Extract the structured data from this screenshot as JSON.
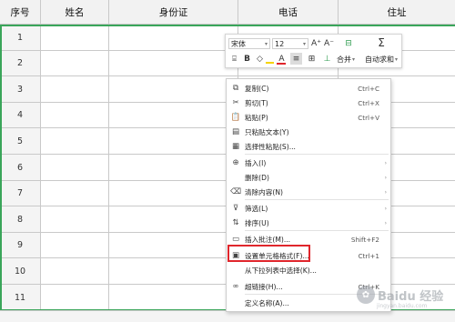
{
  "sheet": {
    "headers": [
      "序号",
      "姓名",
      "身份证",
      "电话",
      "住址"
    ],
    "row_numbers": [
      "1",
      "2",
      "3",
      "4",
      "5",
      "6",
      "7",
      "8",
      "9",
      "10",
      "11"
    ]
  },
  "mini_toolbar": {
    "font_name": "宋体",
    "font_size": "12",
    "grow_font": "A⁺",
    "shrink_font": "A⁻",
    "bold": "B",
    "font_color": "A",
    "merge_label": "合并",
    "autosum_label": "自动求和",
    "accent_colors": {
      "font_color_bar": "#e0262c",
      "fill_color_bar": "#f5d300"
    }
  },
  "context_menu": {
    "items": [
      {
        "label": "复制(C)",
        "shortcut": "Ctrl+C",
        "icon": "copy-icon"
      },
      {
        "label": "剪切(T)",
        "shortcut": "Ctrl+X",
        "icon": "cut-icon"
      },
      {
        "label": "粘贴(P)",
        "shortcut": "Ctrl+V",
        "icon": "paste-icon"
      },
      {
        "label": "只粘贴文本(Y)",
        "shortcut": "",
        "icon": "paste-text-icon"
      },
      {
        "label": "选择性粘贴(S)...",
        "shortcut": "",
        "icon": "paste-special-icon"
      },
      {
        "label": "插入(I)",
        "shortcut": "",
        "icon": "insert-icon",
        "submenu": true
      },
      {
        "label": "删除(D)",
        "shortcut": "",
        "icon": "",
        "submenu": true
      },
      {
        "label": "清除内容(N)",
        "shortcut": "",
        "icon": "eraser-icon",
        "submenu": true
      },
      {
        "label": "筛选(L)",
        "shortcut": "",
        "icon": "filter-icon",
        "submenu": true
      },
      {
        "label": "排序(U)",
        "shortcut": "",
        "icon": "sort-icon",
        "submenu": true
      },
      {
        "label": "插入批注(M)...",
        "shortcut": "Shift+F2",
        "icon": "comment-icon"
      },
      {
        "label": "设置单元格格式(F)...",
        "shortcut": "Ctrl+1",
        "icon": "format-cells-icon"
      },
      {
        "label": "从下拉列表中选择(K)...",
        "shortcut": "",
        "icon": ""
      },
      {
        "label": "超链接(H)...",
        "shortcut": "Ctrl+K",
        "icon": "link-icon"
      },
      {
        "label": "定义名称(A)...",
        "shortcut": "",
        "icon": ""
      }
    ],
    "highlight_color": "#e0262c"
  },
  "watermark": {
    "text": "Baidu 经验",
    "sub": "jingyan.baidu.com"
  },
  "colors": {
    "selection": "#3aa55a"
  }
}
